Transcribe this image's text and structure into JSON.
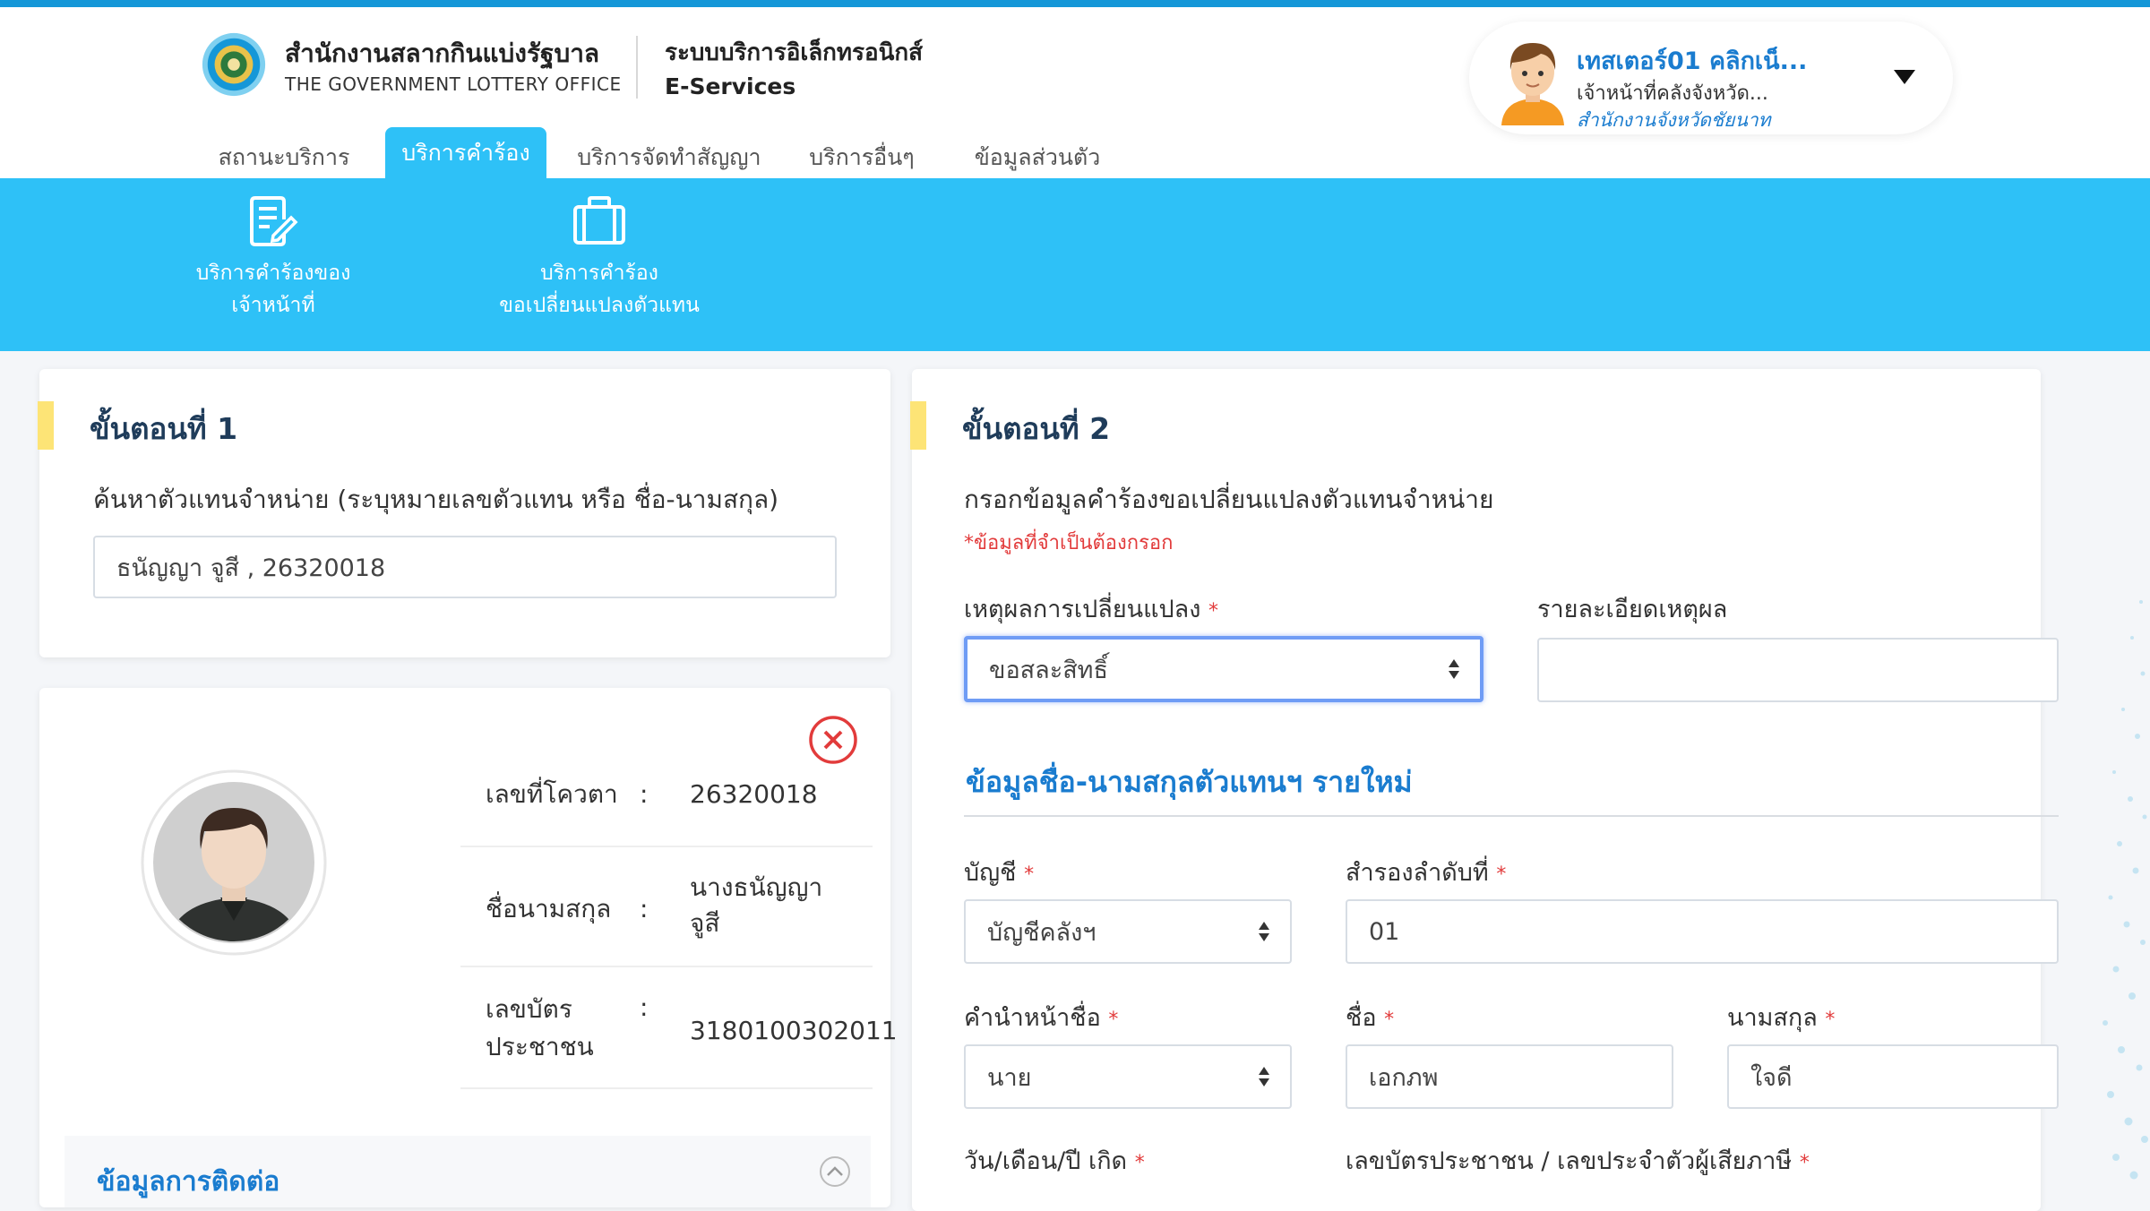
{
  "header": {
    "org_th": "สำนักงานสลากกินแบ่งรัฐบาล",
    "org_en": "THE GOVERNMENT LOTTERY OFFICE",
    "sys_th": "ระบบบริการอิเล็กทรอนิกส์",
    "sys_en": "E-Services"
  },
  "user": {
    "name": "เทสเตอร์01 คลิกเน็...",
    "role": "เจ้าหน้าที่คลังจังหวัด...",
    "office": "สำนักงานจังหวัดชัยนาท"
  },
  "tabs": [
    {
      "label": "สถานะบริการ",
      "active": false
    },
    {
      "label": "บริการคำร้อง",
      "active": true
    },
    {
      "label": "บริการจัดทำสัญญา",
      "active": false
    },
    {
      "label": "บริการอื่นๆ",
      "active": false
    },
    {
      "label": "ข้อมูลส่วนตัว",
      "active": false
    }
  ],
  "subnav": [
    {
      "line1": "บริการคำร้องของ",
      "line2": "เจ้าหน้าที่",
      "icon": "document-edit-icon"
    },
    {
      "line1": "บริการคำร้อง",
      "line2": "ขอเปลี่ยนแปลงตัวแทน",
      "icon": "briefcase-icon"
    }
  ],
  "step1": {
    "title": "ขั้นตอนที่ 1",
    "search_label": "ค้นหาตัวแทนจำหน่าย (ระบุหมายเลขตัวแทน หรือ ชื่อ-นามสกุล)",
    "search_value": "ธนัญญา จูสี , 26320018"
  },
  "agent": {
    "quota_label": "เลขที่โควตา",
    "quota_value": "26320018",
    "name_label": "ชื่อนามสกุล",
    "name_value_1": "นางธนัญญา",
    "name_value_2": "จูสี",
    "id_label_1": "เลขบัตร",
    "id_label_2": "ประชาชน",
    "id_value": "3180100302011",
    "colon": ":",
    "contact_title": "ข้อมูลการติดต่อ"
  },
  "step2": {
    "title": "ขั้นตอนที่ 2",
    "subtitle": "กรอกข้อมูลคำร้องขอเปลี่ยนแปลงตัวแทนจำหน่าย",
    "required_note": "*ข้อมูลที่จำเป็นต้องกรอก",
    "reason_label": "เหตุผลการเปลี่ยนแปลง",
    "reason_value": "ขอสละสิทธิ์",
    "reason_detail_label": "รายละเอียดเหตุผล",
    "reason_detail_value": "",
    "section_title": "ข้อมูลชื่อ-นามสกุลตัวแทนฯ รายใหม่",
    "account_label": "บัญชี",
    "account_value": "บัญชีคลังฯ",
    "reserve_label": "สำรองลำดับที่",
    "reserve_value": "01",
    "prefix_label": "คำนำหน้าชื่อ",
    "prefix_value": "นาย",
    "firstname_label": "ชื่อ",
    "firstname_value": "เอกภพ",
    "lastname_label": "นามสกุล",
    "lastname_value": "ใจดี",
    "dob_label": "วัน/เดือน/ปี เกิด",
    "idcard_label": "เลขบัตรประชาชน / เลขประจำตัวผู้เสียภาษี",
    "req_mark": "*"
  },
  "colors": {
    "topline": "#1597d8",
    "accent": "#2ec1f7",
    "link": "#1a7ccf",
    "title": "#1f3c5a",
    "step_marker": "#fde476",
    "required": "#e23b3b",
    "close": "#e23b3b"
  }
}
